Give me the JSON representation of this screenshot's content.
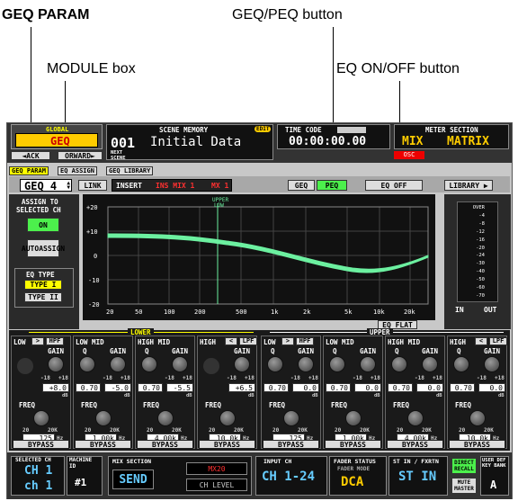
{
  "callouts": {
    "geq_param": "GEQ PARAM",
    "geq_peq_button": "GEQ/PEQ button",
    "module_box": "MODULE box",
    "eq_on_off_button": "EQ ON/OFF button"
  },
  "top": {
    "global": "GLOBAL",
    "geq": "GEQ",
    "back": "ACK",
    "forward": "ORWARD",
    "scene_memory": "SCENE MEMORY",
    "edit": "EDIT",
    "scene_number": "001",
    "scene_name": "Initial Data",
    "next_scene": "NEXT SCENE",
    "time_code": "TIME CODE",
    "time_value": "00:00:00.00",
    "meter_section": "METER SECTION",
    "mix": "MIX",
    "matrix": "MATRIX",
    "osc": "OSC"
  },
  "tabs": [
    "GEQ PARAM",
    "EQ ASSIGN",
    "GEQ LIBRARY"
  ],
  "module": {
    "value": "GEQ 4",
    "link": "LINK",
    "insert": "INSERT",
    "ins_mix": "INS MIX 1",
    "mx": "MX 1",
    "geq": "GEQ",
    "peq": "PEQ",
    "eq_off": "EQ OFF",
    "library": "LIBRARY"
  },
  "left": {
    "assign_to": "ASSIGN TO",
    "selected_ch": "SELECTED CH",
    "on": "ON",
    "auto": "AUTO",
    "assign": "ASSIGN",
    "eq_type": "EQ TYPE",
    "type1": "TYPE I",
    "type2": "TYPE II"
  },
  "graph": {
    "upper": "UPPER",
    "low": "LOW",
    "y_ticks": [
      "+20",
      "+10",
      "0",
      "-10",
      "-20"
    ],
    "x_ticks": [
      "20",
      "50",
      "100",
      "200",
      "500",
      "1k",
      "2k",
      "5k",
      "10k",
      "20k"
    ],
    "eq_flat": "EQ FLAT"
  },
  "meter": {
    "ticks": [
      "OVER",
      "-4",
      "-8",
      "-12",
      "-16",
      "-20",
      "-24",
      "-30",
      "-40",
      "-50",
      "-60",
      "-70"
    ],
    "in": "IN",
    "out": "OUT"
  },
  "lower": {
    "title": "LOWER",
    "bands": [
      {
        "name": "LOW",
        "gain": "+8.0",
        "q": "",
        "freq": "125",
        "filter": "HPF",
        "unit": "Hz"
      },
      {
        "name": "LOW MID",
        "gain": "-5.0",
        "q": "0.70",
        "freq": "1.00k",
        "unit": "Hz"
      },
      {
        "name": "HIGH MID",
        "gain": "-5.5",
        "q": "0.70",
        "freq": "4.00k",
        "unit": "Hz"
      },
      {
        "name": "HIGH",
        "gain": "+6.5",
        "q": "",
        "freq": "10.0k",
        "filter": "LPF",
        "unit": "Hz"
      }
    ]
  },
  "upper": {
    "title": "UPPER",
    "bands": [
      {
        "name": "LOW",
        "gain": "0.0",
        "q": "0.70",
        "freq": "125",
        "filter": "HPF",
        "unit": "Hz"
      },
      {
        "name": "LOW MID",
        "gain": "0.0",
        "q": "0.70",
        "freq": "1.00k",
        "unit": "Hz"
      },
      {
        "name": "HIGH MID",
        "gain": "0.0",
        "q": "0.70",
        "freq": "4.00k",
        "unit": "Hz"
      },
      {
        "name": "HIGH",
        "gain": "0.0",
        "q": "0.70",
        "freq": "10.0k",
        "filter": "LPF",
        "unit": "Hz"
      }
    ]
  },
  "labels": {
    "q": "Q",
    "gain": "GAIN",
    "freq": "FREQ",
    "bypass": "BYPASS",
    "range_lo": "-18",
    "range_hi": "+18",
    "db": "dB",
    "f_lo": "20",
    "f_hi": "20K"
  },
  "bottom": {
    "selected_ch": "SELECTED CH",
    "ch1": "CH 1",
    "ch1_lower": "ch 1",
    "machine_id": "MACHINE ID",
    "machine_num": "#1",
    "mix_section": "MIX SECTION",
    "send": "SEND",
    "mx20": "MX20",
    "ch_level": "CH LEVEL",
    "input_ch": "INPUT CH",
    "ch_range": "CH 1-24",
    "fader_status": "FADER STATUS",
    "fader_mode": "FADER MODE",
    "dca": "DCA",
    "st_in_fxrtn": "ST IN / FXRTN",
    "st_in": "ST IN",
    "direct_recall": "DIRECT RECALL",
    "mute_master": "MUTE MASTER",
    "user_def": "USER DEF KEY BANK",
    "bank": "A"
  },
  "colors": {
    "eq_curve": "#6cf0a0",
    "green": "#4cf04c",
    "red": "#ff2020",
    "yellow": "#ffff00"
  }
}
